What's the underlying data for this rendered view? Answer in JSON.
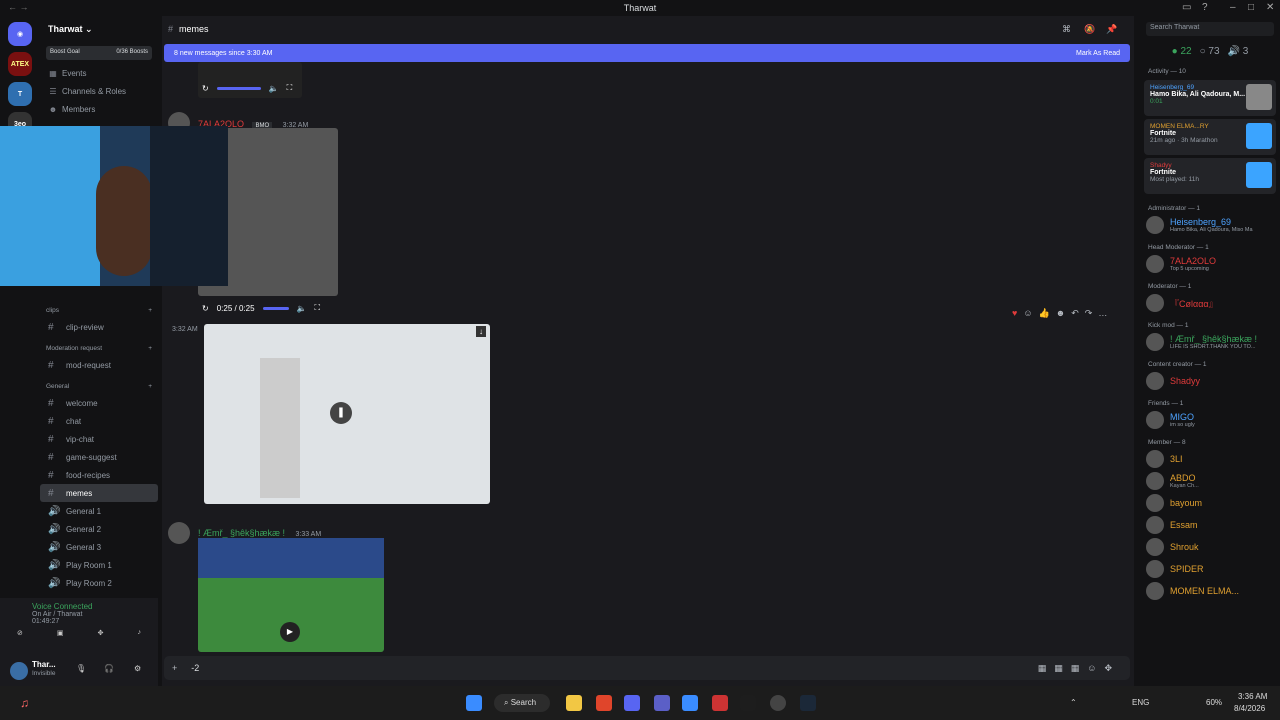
{
  "window": {
    "title": "Tharwat"
  },
  "server": {
    "name": "Tharwat",
    "boost_goal": "Boost Goal",
    "boost_count": "0/36 Boosts"
  },
  "nav": {
    "events": "Events",
    "roles": "Channels & Roles",
    "members": "Members"
  },
  "categories": {
    "clips": "clips",
    "moderation": "Moderation request",
    "general": "General"
  },
  "channels": [
    {
      "icon": "#",
      "label": "clip-review"
    },
    {
      "icon": "#",
      "label": "mod-request"
    },
    {
      "icon": "#",
      "label": "welcome"
    },
    {
      "icon": "#",
      "label": "chat"
    },
    {
      "icon": "#",
      "label": "vip-chat"
    },
    {
      "icon": "#",
      "label": "game-suggest"
    },
    {
      "icon": "#",
      "label": "food-recipes"
    },
    {
      "icon": "#",
      "label": "memes"
    }
  ],
  "voice_channels": [
    "General 1",
    "General 2",
    "General 3",
    "Play Room 1",
    "Play Room 2"
  ],
  "voice": {
    "status": "Voice Connected",
    "where": "On Air / Tharwat",
    "time": "01:49:27"
  },
  "user": {
    "name": "Thar...",
    "status": "Invisible"
  },
  "channel_header": {
    "name": "memes"
  },
  "banner": {
    "text": "8 new messages since 3:30 AM",
    "action": "Mark As Read"
  },
  "messages": [
    {
      "author": "7ALA2OLO",
      "badge": "BMO",
      "time": "3:32 AM",
      "video_time": "0:25 / 0:25"
    },
    {
      "time": "3:32 AM"
    },
    {
      "author": "! Æmř_ §hêk§hækæ !",
      "time": "3:33 AM"
    }
  ],
  "composer": {
    "value": "-2"
  },
  "members_panel": {
    "search_placeholder": "Search Tharwat",
    "online": "22",
    "members": "73",
    "voice": "3",
    "activity_header": "Activity — 10",
    "activities": [
      {
        "user": "Heisenberg_69",
        "title": "Hamo Bika, Ali Qadoura, M...",
        "sub": "0:01"
      },
      {
        "user": "MOMEN ELMA...RY",
        "title": "Fortnite",
        "sub": "21m ago · 3h Marathon"
      },
      {
        "user": "Shadyy",
        "title": "Fortnite",
        "sub": "Most played: 11h"
      }
    ],
    "groups": [
      {
        "label": "Administrator — 1",
        "members": [
          {
            "name": "Heisenberg_69",
            "sub": "Hamo Bika, Ali Qadoura, Miso Ma",
            "color": "#4ea3ff"
          }
        ]
      },
      {
        "label": "Head Moderator — 1",
        "members": [
          {
            "name": "7ALA2OLO",
            "sub": "Top 5 upcoming",
            "color": "#e03b3b"
          }
        ]
      },
      {
        "label": "Moderator — 1",
        "members": [
          {
            "name": "『Cølααα』",
            "sub": "",
            "color": "#e03b3b"
          }
        ]
      },
      {
        "label": "Kick mod — 1",
        "members": [
          {
            "name": "! Æmř_ §hêk§hækæ !",
            "sub": "LIFE IS SHORT.THANK YOU TO...",
            "color": "#3ba55d"
          }
        ]
      },
      {
        "label": "Content creator — 1",
        "members": [
          {
            "name": "Shadyy",
            "sub": "",
            "color": "#e03b3b"
          }
        ]
      },
      {
        "label": "Friends — 1",
        "members": [
          {
            "name": "MIGO",
            "sub": "im so ugly",
            "color": "#4ea3ff"
          }
        ]
      },
      {
        "label": "Member — 8",
        "members": [
          {
            "name": "3LI",
            "sub": "",
            "color": "#e0a030"
          },
          {
            "name": "ABDO",
            "sub": "Kayan Ch...",
            "color": "#e0a030"
          },
          {
            "name": "bayoum",
            "sub": "",
            "color": "#e0a030"
          },
          {
            "name": "Essam",
            "sub": "",
            "color": "#e0a030"
          },
          {
            "name": "Shrouk",
            "sub": "",
            "color": "#e0a030"
          },
          {
            "name": "SPIDER",
            "sub": "",
            "color": "#e0a030"
          },
          {
            "name": "MOMEN ELMA...",
            "sub": "",
            "color": "#e0a030"
          }
        ]
      }
    ]
  },
  "taskbar": {
    "search": "Search",
    "lang": "ENG",
    "battery": "60%",
    "time": "3:36 AM",
    "date": "8/4/2026"
  }
}
